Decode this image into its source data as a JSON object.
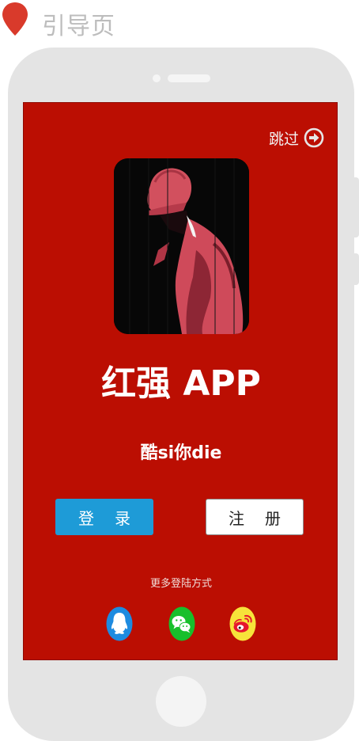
{
  "header": {
    "title": "引导页",
    "pin_color": "#d93a2b"
  },
  "screen": {
    "background": "#bb0e02",
    "skip_label": "跳过",
    "app_title": "红强 APP",
    "slogan": "酷si你die",
    "login_label": "登录",
    "register_label": "注册",
    "more_login_label": "更多登陆方式",
    "social_icons": [
      "qq-icon",
      "wechat-icon",
      "weibo-icon"
    ],
    "colors": {
      "login_button": "#1e9bd7",
      "qq": "#1e8be0",
      "wechat": "#18bf2b",
      "weibo": "#f7e33a"
    }
  }
}
